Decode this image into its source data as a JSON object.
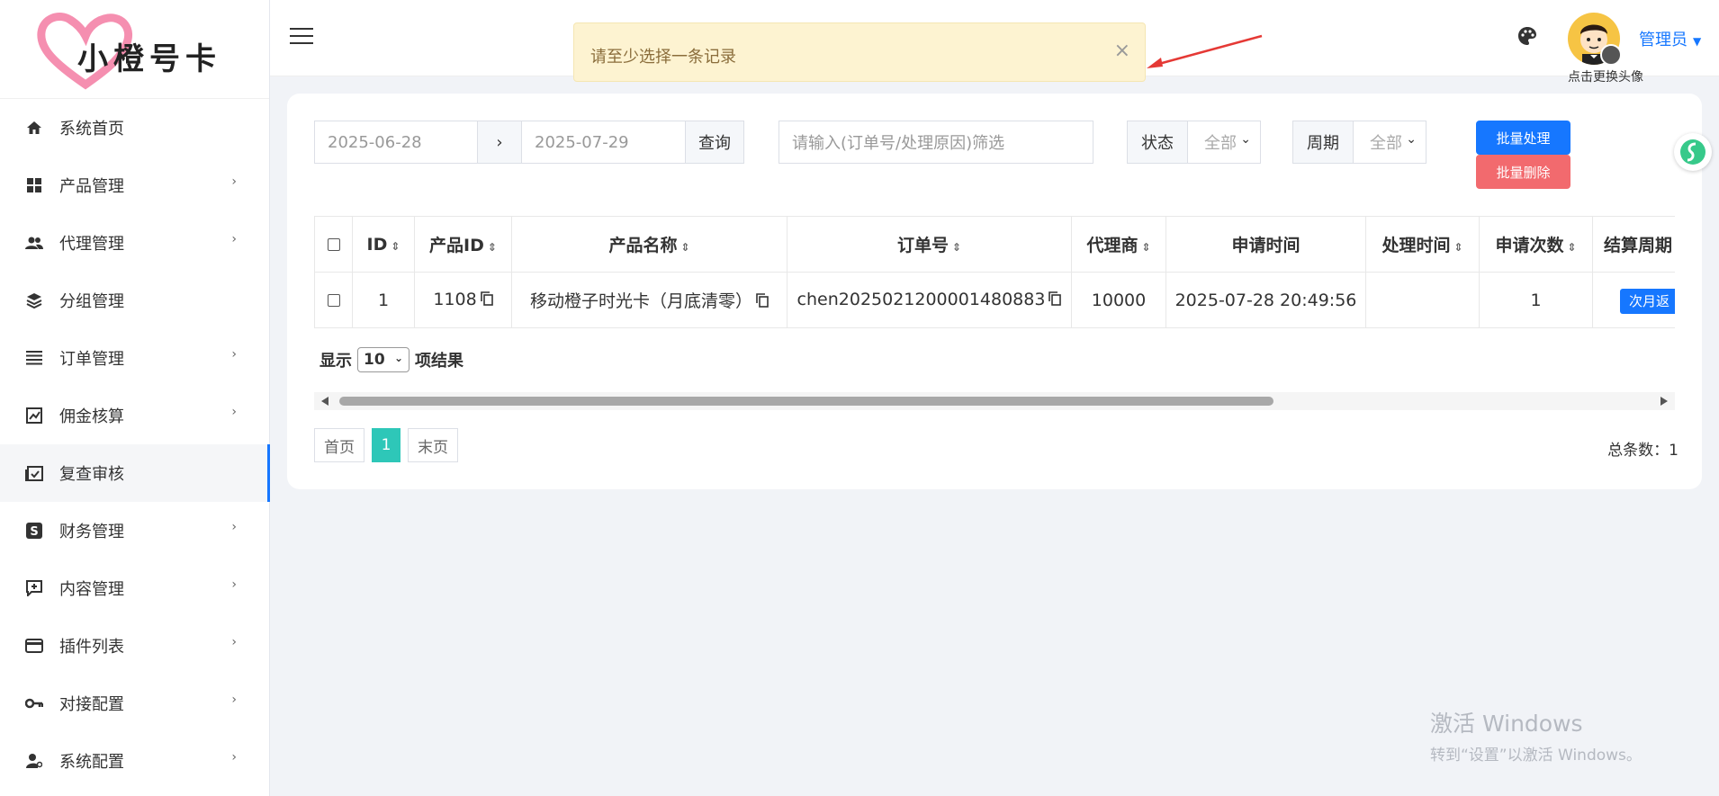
{
  "logo": {
    "text": "小橙号卡"
  },
  "sidebar": {
    "items": [
      {
        "label": "系统首页",
        "icon": "home-icon",
        "arrow": ""
      },
      {
        "label": "产品管理",
        "icon": "grid-icon",
        "arrow": "›"
      },
      {
        "label": "代理管理",
        "icon": "users-icon",
        "arrow": "›"
      },
      {
        "label": "分组管理",
        "icon": "layers-icon",
        "arrow": ""
      },
      {
        "label": "订单管理",
        "icon": "list-icon",
        "arrow": "›"
      },
      {
        "label": "佣金核算",
        "icon": "chart-box-icon",
        "arrow": "›"
      },
      {
        "label": "复查审核",
        "icon": "calendar-check-icon",
        "arrow": ""
      },
      {
        "label": "财务管理",
        "icon": "dollar-icon",
        "arrow": "›"
      },
      {
        "label": "内容管理",
        "icon": "comment-plus-icon",
        "arrow": "›"
      },
      {
        "label": "插件列表",
        "icon": "card-icon",
        "arrow": "›"
      },
      {
        "label": "对接配置",
        "icon": "key-icon",
        "arrow": "›"
      },
      {
        "label": "系统配置",
        "icon": "user-cog-icon",
        "arrow": "›"
      }
    ]
  },
  "header": {
    "admin_label": "管理员",
    "avatar_hint": "点击更换头像"
  },
  "toast": {
    "message": "请至少选择一条记录",
    "close": "×"
  },
  "filters": {
    "start_date": "2025-06-28",
    "range_sep": "›",
    "end_date": "2025-07-29",
    "query_label": "查询",
    "search_placeholder": "请输入(订单号/处理原因)筛选",
    "status_label": "状态",
    "status_value": "全部",
    "cycle_label": "周期",
    "cycle_value": "全部"
  },
  "actions": {
    "batch_process": "批量处理",
    "batch_delete": "批量删除"
  },
  "table": {
    "columns": [
      "ID",
      "产品ID",
      "产品名称",
      "订单号",
      "代理商",
      "申请时间",
      "处理时间",
      "申请次数",
      "结算周期"
    ],
    "rows": [
      {
        "id": "1",
        "product_id": "1108",
        "product_name": "移动橙子时光卡（月底清零）",
        "order_no": "chen2025021200001480883",
        "agent": "10000",
        "apply_time": "2025-07-28 20:49:56",
        "process_time": "",
        "apply_count": "1",
        "cycle": "次月返"
      }
    ]
  },
  "pagination": {
    "show_label": "显示",
    "page_size": "10",
    "result_label": "项结果",
    "first": "首页",
    "current": "1",
    "last": "末页",
    "total": "总条数：1"
  },
  "watermark": {
    "line1": "激活 Windows",
    "line2": "转到“设置”以激活 Windows。"
  },
  "colors": {
    "primary": "#1677ff",
    "danger": "#f26a6e",
    "page_active": "#2ec7b8",
    "toast_bg": "#fdf3d1"
  }
}
